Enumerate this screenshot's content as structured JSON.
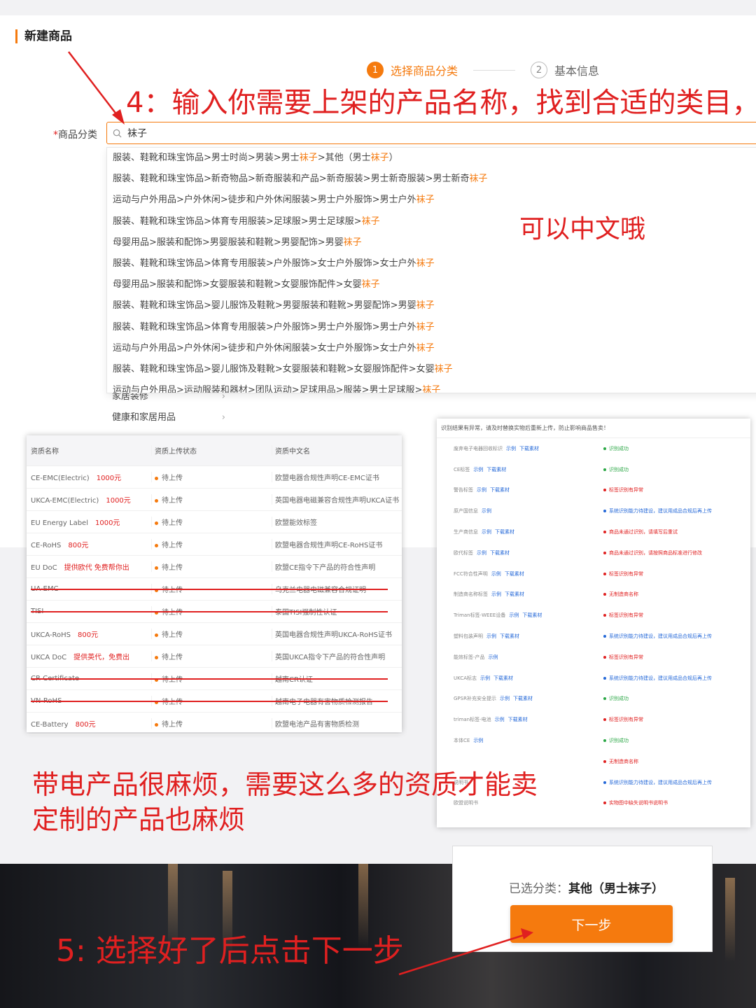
{
  "page": {
    "title": "新建商品"
  },
  "steps": [
    {
      "num": "1",
      "label": "选择商品分类"
    },
    {
      "num": "2",
      "label": "基本信息"
    }
  ],
  "annotations": {
    "step4": "4：输入你需要上架的产品名称，找到合适的类目，",
    "chinese_ok": "可以中文哦",
    "electric_1": "带电产品很麻烦，需要这么多的资质才能卖",
    "electric_2": "定制的产品也麻烦",
    "step5": "5: 选择好了后点击下一步"
  },
  "category_field": {
    "required": "*",
    "label": "商品分类",
    "value": "袜子"
  },
  "dropdown": [
    {
      "path": "服装、鞋靴和珠宝饰品>男士时尚>男装>男士",
      "hl": "袜子",
      "rest": ">其他（男士",
      "hl2": "袜子",
      "tail": "）"
    },
    {
      "path": "服装、鞋靴和珠宝饰品>新奇物品>新奇服装和产品>新奇服装>男士新奇服装>男士新奇",
      "hl": "袜子"
    },
    {
      "path": "运动与户外用品>户外休闲>徒步和户外休闲服装>男士户外服饰>男士户外",
      "hl": "袜子"
    },
    {
      "path": "服装、鞋靴和珠宝饰品>体育专用服装>足球服>男士足球服>",
      "hl": "袜子"
    },
    {
      "path": "母婴用品>服装和配饰>男婴服装和鞋靴>男婴配饰>男婴",
      "hl": "袜子"
    },
    {
      "path": "服装、鞋靴和珠宝饰品>体育专用服装>户外服饰>女士户外服饰>女士户外",
      "hl": "袜子"
    },
    {
      "path": "母婴用品>服装和配饰>女婴服装和鞋靴>女婴服饰配件>女婴",
      "hl": "袜子"
    },
    {
      "path": "服装、鞋靴和珠宝饰品>婴儿服饰及鞋靴>男婴服装和鞋靴>男婴配饰>男婴",
      "hl": "袜子"
    },
    {
      "path": "服装、鞋靴和珠宝饰品>体育专用服装>户外服饰>男士户外服饰>男士户外",
      "hl": "袜子"
    },
    {
      "path": "运动与户外用品>户外休闲>徒步和户外休闲服装>女士户外服饰>女士户外",
      "hl": "袜子"
    },
    {
      "path": "服装、鞋靴和珠宝饰品>婴儿服饰及鞋靴>女婴服装和鞋靴>女婴服饰配件>女婴",
      "hl": "袜子"
    },
    {
      "path": "运动与户外用品>运动服装和器材>团队运动>足球用品>服装>男士足球服>",
      "hl": "袜子"
    }
  ],
  "left_menu": [
    "家居装修",
    "健康和家居用品"
  ],
  "qualification_table": {
    "headers": [
      "资质名称",
      "资质上传状态",
      "资质中文名"
    ],
    "rows": [
      {
        "name": "CE-EMC(Electric)",
        "price": "1000元",
        "status": "待上传",
        "cn": "欧盟电器合规性声明CE-EMC证书"
      },
      {
        "name": "UKCA-EMC(Electric)",
        "price": "1000元",
        "status": "待上传",
        "cn": "英国电器电磁兼容合规性声明UKCA证书"
      },
      {
        "name": "EU Energy Label",
        "price": "1000元",
        "status": "待上传",
        "cn": "欧盟能效标签"
      },
      {
        "name": "CE-RoHS",
        "price": "800元",
        "status": "待上传",
        "cn": "欧盟电器合规性声明CE-RoHS证书"
      },
      {
        "name": "EU DoC",
        "price": "提供欧代 免费帮你出",
        "status": "待上传",
        "cn": "欧盟CE指令下产品的符合性声明"
      },
      {
        "name": "UA-EMC",
        "price": "",
        "status": "待上传",
        "cn": "乌克兰电器电磁兼容合规证明",
        "struck": true
      },
      {
        "name": "TISI",
        "price": "",
        "status": "待上传",
        "cn": "泰国TISI强制性认证",
        "struck": true
      },
      {
        "name": "UKCA-RoHS",
        "price": "800元",
        "status": "待上传",
        "cn": "英国电器合规性声明UKCA-RoHS证书"
      },
      {
        "name": "UKCA DoC",
        "price": "提供英代，免费出",
        "status": "待上传",
        "cn": "英国UKCA指令下产品的符合性声明"
      },
      {
        "name": "CR Certificate",
        "price": "",
        "status": "待上传",
        "cn": "越南CR认证",
        "struck": true
      },
      {
        "name": "VN-RoHS",
        "price": "",
        "status": "待上传",
        "cn": "越南电子电器有害物质检测报告",
        "struck": true
      },
      {
        "name": "CE-Battery",
        "price": "800元",
        "status": "待上传",
        "cn": "欧盟电池产品有害物质检测"
      }
    ]
  },
  "material_panel": {
    "notice": "识别结果有异常，请及时替换实物后重新上传，防止影响商品售卖！",
    "rows": [
      {
        "name": "废弃电子电器回收标识",
        "links": [
          "示例",
          "下载素材"
        ],
        "status": "识别成功",
        "color": "#2aa745"
      },
      {
        "name": "CE标签",
        "links": [
          "示例",
          "下载素材"
        ],
        "status": "识别成功",
        "color": "#2aa745"
      },
      {
        "name": "警告标签",
        "links": [
          "示例",
          "下载素材"
        ],
        "status": "标签识别有异常",
        "color": "#e02020"
      },
      {
        "name": "原产国信息",
        "links": [
          "示例"
        ],
        "status": "系统识别能力待建设，建议用成品合规后再上传",
        "color": "#2468d8"
      },
      {
        "name": "生产商信息",
        "links": [
          "示例",
          "下载素材"
        ],
        "status": "商品未通过识别，请填写后重试",
        "color": "#e02020"
      },
      {
        "name": "欧代标签",
        "links": [
          "示例",
          "下载素材"
        ],
        "status": "商品未通过识别，请按照商品标准进行修改",
        "color": "#e02020"
      },
      {
        "name": "FCC符合性声明",
        "links": [
          "示例",
          "下载素材"
        ],
        "status": "标签识别有异常",
        "color": "#e02020"
      },
      {
        "name": "制造商名称标签",
        "links": [
          "示例",
          "下载素材"
        ],
        "status": "无制造商名称",
        "color": "#e02020"
      },
      {
        "name": "Triman标签-WEEE设备",
        "links": [
          "示例",
          "下载素材"
        ],
        "status": "标签识别有异常",
        "color": "#e02020"
      },
      {
        "name": "塑料包装声明",
        "links": [
          "示例",
          "下载素材"
        ],
        "status": "系统识别能力待建设，建议用成品合规后再上传",
        "color": "#2468d8"
      },
      {
        "name": "能效标签-产品",
        "links": [
          "示例"
        ],
        "status": "标签识别有异常",
        "color": "#e02020"
      },
      {
        "name": "UKCA标志",
        "links": [
          "示例",
          "下载素材"
        ],
        "status": "系统识别能力待建设，建议用成品合规后再上传",
        "color": "#2468d8"
      },
      {
        "name": "GPSR补充安全提示",
        "links": [
          "示例",
          "下载素材"
        ],
        "status": "识别成功",
        "color": "#2aa745"
      },
      {
        "name": "triman标签-电池",
        "links": [
          "示例",
          "下载素材"
        ],
        "status": "标签识别有异常",
        "color": "#e02020"
      },
      {
        "name": "本体CE",
        "links": [
          "示例"
        ],
        "status": "识别成功",
        "color": "#2aa745"
      },
      {
        "name": "",
        "links": [],
        "status": "无制造商名称",
        "color": "#e02020"
      },
      {
        "name": "说明书",
        "links": [],
        "status": "系统识别能力待建设，建议用成品合规后再上传",
        "color": "#2468d8"
      },
      {
        "name": "欧盟说明书",
        "links": [],
        "status": "实物图中缺失说明书说明书",
        "color": "#e02020"
      }
    ]
  },
  "selection": {
    "prefix": "已选分类：",
    "value": "其他（男士袜子）",
    "next_label": "下一步"
  },
  "colors": {
    "accent": "#f57a0e",
    "annotation": "#e02020",
    "link": "#2468d8",
    "success": "#2aa745"
  }
}
